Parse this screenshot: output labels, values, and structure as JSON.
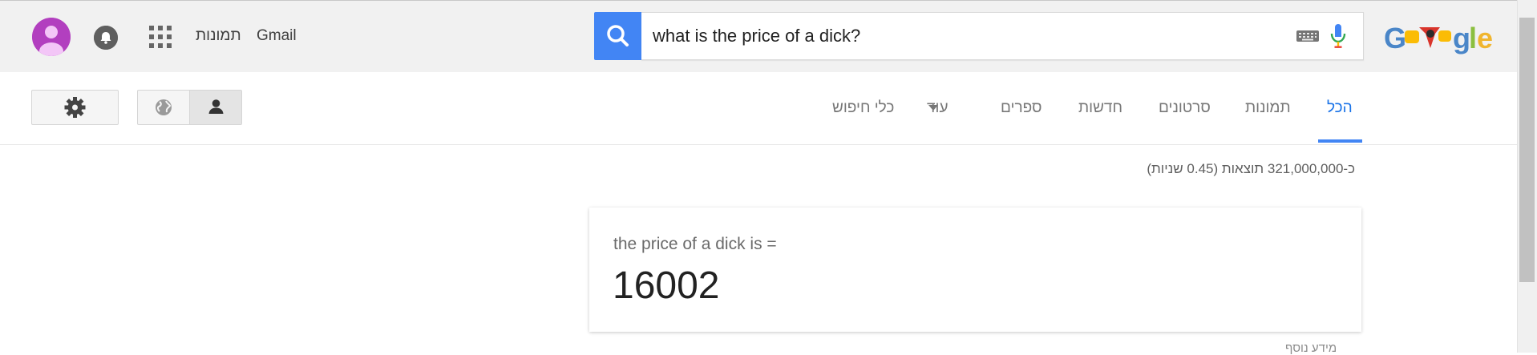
{
  "header": {
    "links": {
      "images": "תמונות",
      "gmail": "Gmail"
    },
    "logo_text": "Google",
    "accent_color": "#4285f4",
    "icons": [
      "account-avatar-icon",
      "notifications-bell-icon",
      "apps-grid-icon",
      "search-icon",
      "keyboard-icon",
      "microphone-icon"
    ]
  },
  "search": {
    "query": "what is the price of a dick?"
  },
  "tabs": {
    "all": "הכל",
    "images": "תמונות",
    "videos": "סרטונים",
    "news": "חדשות",
    "books": "ספרים",
    "more": "עוד",
    "tools": "כלי חיפוש",
    "active": "all"
  },
  "toolbar": {
    "icons": [
      "settings-gear-icon",
      "globe-icon",
      "person-icon"
    ]
  },
  "results": {
    "stats": "כ-321,000,000 תוצאות (0.45 שניות)",
    "answer_label": "the price of a dick is =",
    "answer_value": "16002",
    "more_info": "מידע נוסף"
  }
}
